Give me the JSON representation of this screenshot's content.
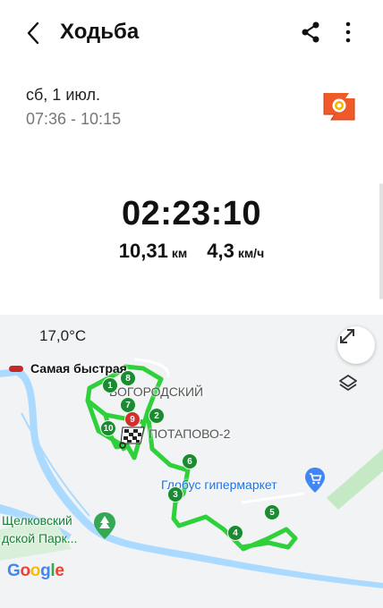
{
  "header": {
    "title": "Ходьба"
  },
  "workout": {
    "date": "сб, 1 июл.",
    "time_range": "07:36 - 10:15",
    "duration": "02:23:10",
    "distance_value": "10,31",
    "distance_unit": "км",
    "speed_value": "4,3",
    "speed_unit": "км/ч"
  },
  "map": {
    "temperature": "17,0°C",
    "legend_label": "Самая быстрая",
    "places": {
      "district": "БОГОРОДСКИЙ",
      "village": "ПОТАПОВО-2",
      "store": "Глобус гипермаркет",
      "park_line1": "Щелковский",
      "park_line2": "дской Парк..."
    },
    "markers": [
      "1",
      "8",
      "7",
      "9",
      "2",
      "10",
      "6",
      "3",
      "5",
      "4"
    ],
    "logo": {
      "g1": "G",
      "o1": "o",
      "o2": "o",
      "g2": "g",
      "l": "l",
      "e": "e"
    }
  },
  "colors": {
    "route": "#2fd13b",
    "marker": "#1b8a32",
    "fastest": "#c62828",
    "water": "#aadaff",
    "park": "#c5e8c5"
  },
  "icons": [
    "back-arrow-icon",
    "share-icon",
    "more-vert-icon",
    "flag-badge-icon",
    "expand-icon",
    "layers-icon",
    "store-pin-icon",
    "tree-icon",
    "finish-flag-icon"
  ]
}
